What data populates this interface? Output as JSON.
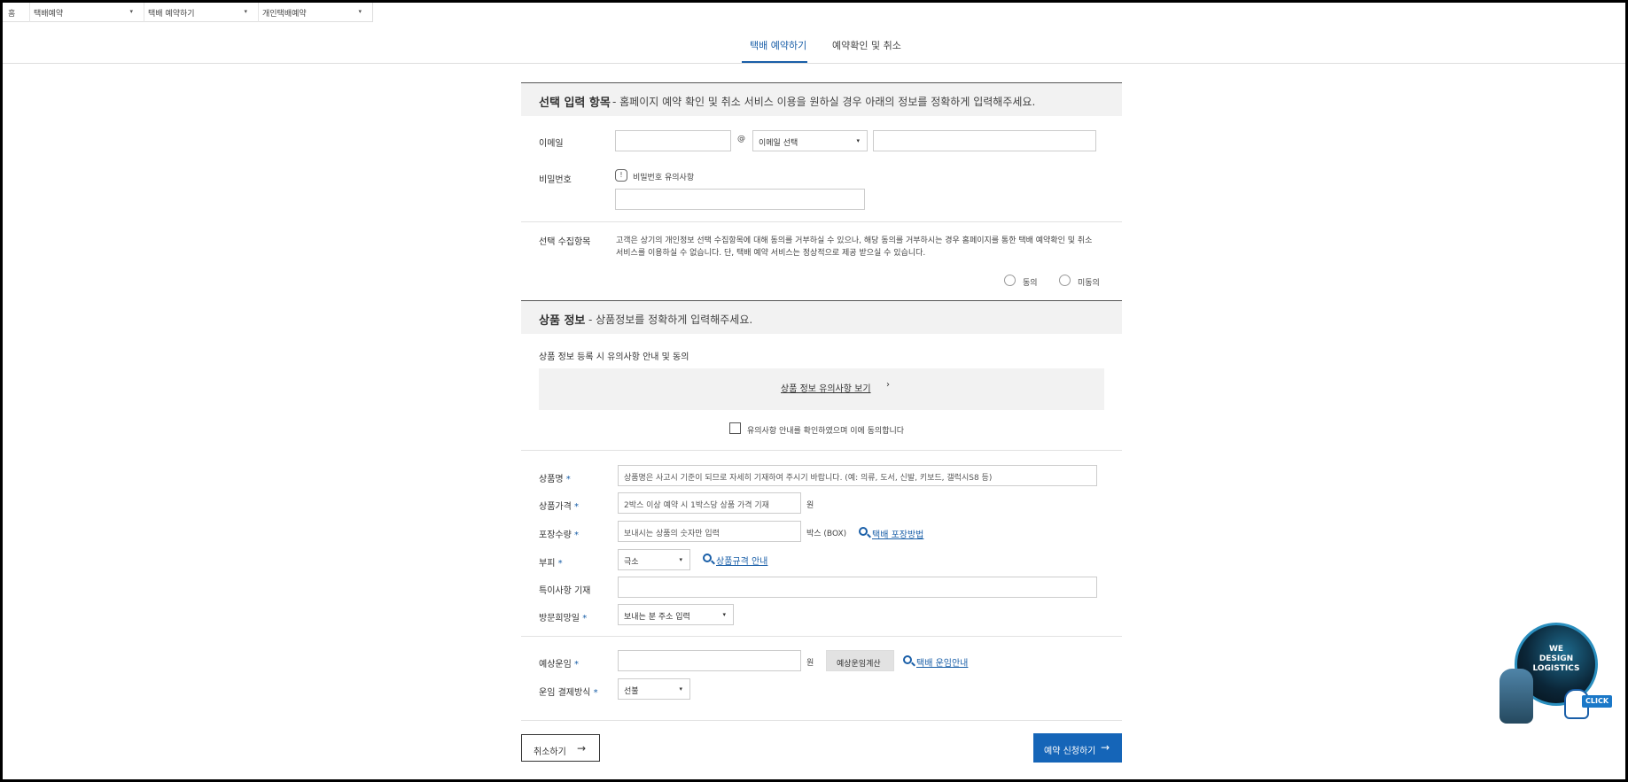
{
  "nav": {
    "home_label": "홈",
    "items": [
      {
        "label": "택배예약"
      },
      {
        "label": "택배 예약하기"
      },
      {
        "label": "개인택배예약"
      }
    ]
  },
  "tabs": [
    {
      "label": "택배 예약하기",
      "active": true
    },
    {
      "label": "예약확인 및 취소",
      "active": false
    }
  ],
  "optional_section": {
    "title": "선택 입력 항목",
    "subtitle": "- 홈페이지 예약 확인 및 취소 서비스 이용을 원하실 경우 아래의 정보를 정확하게 입력해주세요.",
    "email_label": "이메일",
    "email_at": "@",
    "email_domain_select": "이메일 선택",
    "password_label": "비밀번호",
    "password_notice": "비밀번호 유의사항",
    "consent_label": "선택 수집항목",
    "consent_text_1": "고객은 상기의 개인정보 선택 수집항목에 대해 동의를 거부하실 수 있으나, 해당 동의를 거부하시는 경우 홈페이지를 통한 택배 예약확인 및 취소",
    "consent_text_2": "서비스를 이용하실 수 없습니다. 단, 택배 예약 서비스는 정상적으로 제공 받으실 수 있습니다.",
    "agree": "동의",
    "disagree": "미동의"
  },
  "product_section": {
    "title": "상품 정보",
    "subtitle": "- 상품정보를 정확하게 입력해주세요.",
    "notice_heading": "상품 정보 등록 시 유의사항 안내 및 동의",
    "notice_link": "상품 정보 유의사항 보기",
    "notice_chevron": "›",
    "notice_check": "유의사항 안내를 확인하였으며 이에 동의합니다",
    "name_label": "상품명",
    "name_placeholder": "상품명은 사고시 기준이 되므로 자세히 기재하여 주시기 바랍니다. (예: 의류, 도서, 신발, 키보드, 갤럭시S8 등)",
    "price_label": "상품가격",
    "price_placeholder": "2박스 이상 예약 시 1박스당 상품 가격 기재",
    "price_unit": "원",
    "qty_label": "포장수량",
    "qty_placeholder": "보내시는 상품의 숫자만 입력",
    "qty_unit": "박스 (BOX)",
    "qty_link": "택배 포장방법",
    "size_label": "부피",
    "size_select": "극소",
    "size_link": "상품규격 안내",
    "special_label": "특이사항 기재",
    "visit_label": "방문희망일",
    "visit_select": "보내는 분 주소 입력",
    "req_mark": "*"
  },
  "fee_section": {
    "fee_label": "예상운임",
    "fee_unit": "원",
    "calc_button": "예상운임계산",
    "fee_link": "택배 운임안내",
    "pay_label": "운임 결제방식",
    "pay_select": "선불"
  },
  "actions": {
    "cancel": "취소하기",
    "submit": "예약 신청하기",
    "arrow": "→"
  },
  "banner": {
    "line1": "WE",
    "line2": "DESIGN",
    "line3": "LOGISTICS",
    "click": "CLICK"
  },
  "caret": "▾"
}
